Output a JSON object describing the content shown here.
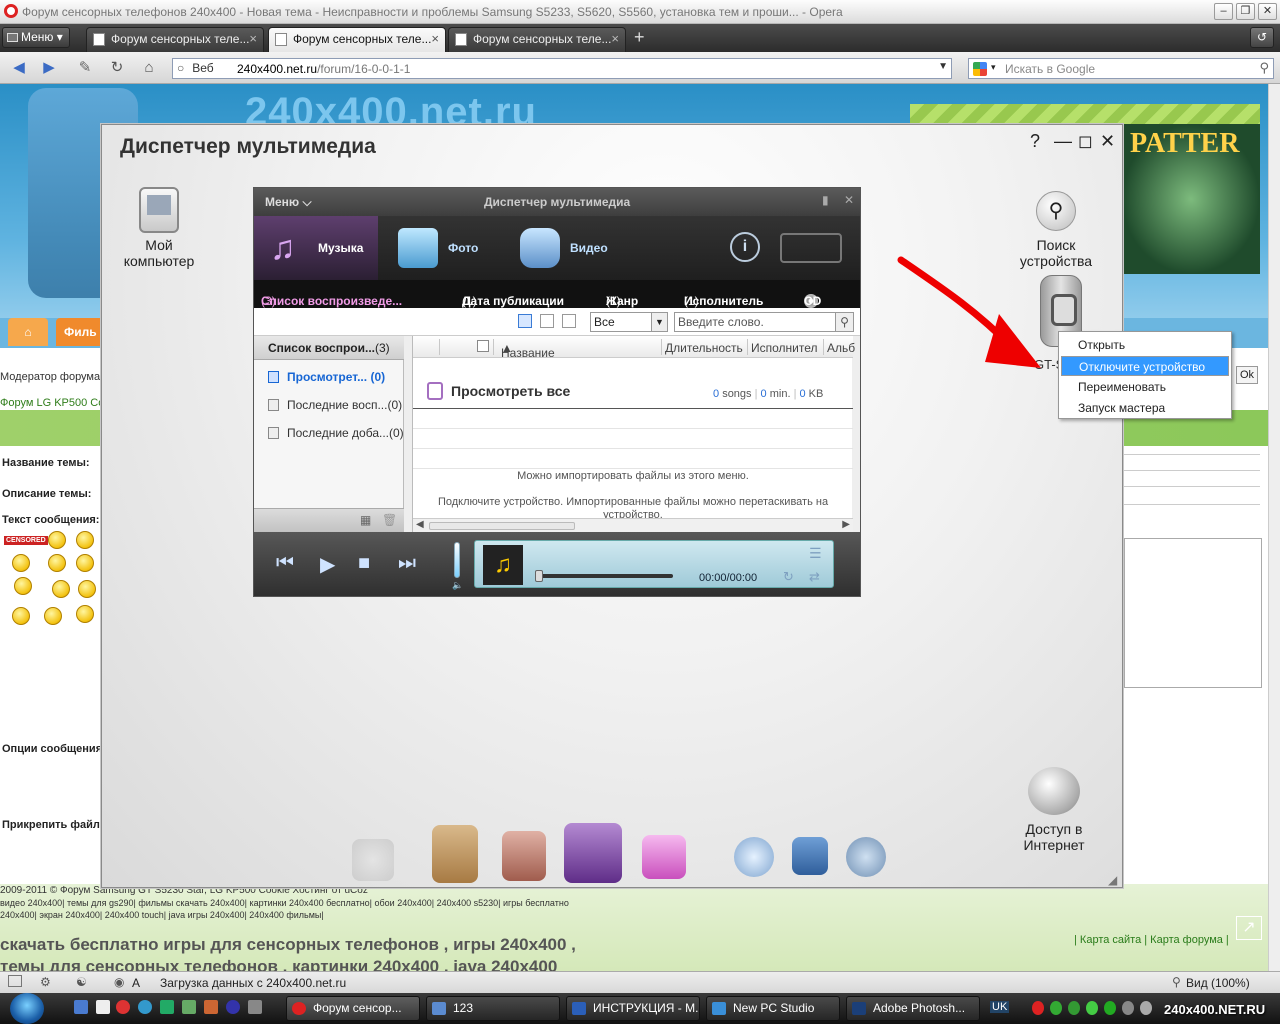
{
  "browser": {
    "title": "Форум сенсорных телефонов 240x400 - Новая тема - Неисправности и проблемы Samsung S5233, S5620, S5560, установка тем и проши... - Opera",
    "menu_label": "Меню",
    "tabs": [
      {
        "label": "Форум сенсорных теле..."
      },
      {
        "label": "Форум сенсорных теле..."
      },
      {
        "label": "Форум сенсорных теле..."
      }
    ],
    "address_mode": "Веб",
    "url_host": "240x400.net.ru",
    "url_path": "/forum/16-0-0-1-1",
    "search_placeholder": "Искать в Google",
    "status_text": "Загрузка данных с 240x400.net.ru",
    "zoom": "Вид (100%)",
    "status_a": "A"
  },
  "webpage": {
    "banner_text": "240x400.net.ru",
    "patter": "PATTER",
    "film_tab": "Филь",
    "moderator": "Модератор форума:",
    "forum_link": "Форум LG KP500 Coo",
    "topic_name": "Название темы:",
    "topic_desc": "Описание темы:",
    "message_text": "Текст сообщения:",
    "msg_options": "Опции сообщения",
    "attach_file": "Прикрепить файл",
    "ok": "Ok",
    "censored": "CENSORED",
    "footer_line1": "2009-2011 © Форум Samsung GT S5230 Star, LG KP500 Cookie Хостинг от uCoz",
    "footer_line2": "видео 240x400| темы для gs290| фильмы скачать 240x400| картинки 240x400 бесплатно| обои 240x400| 240x400 s5230| игры бесплатно",
    "footer_line3": "240x400| экран 240x400| 240x400 touch| java игры 240x400| 240x400 фильмы|",
    "footer_links": "| Карта сайта | Карта форума |",
    "footer_big1": "скачать бесплатно игры для сенсорных телефонов , игры 240x400 ,",
    "footer_big2": "темы для сенсорных телефонов , картинки 240x400 , java 240x400"
  },
  "media_manager": {
    "title": "Диспетчер мультимедиа",
    "help": "?",
    "my_computer": "Мой компьютер",
    "device_search": "Поиск устройства",
    "device_label": "GT-S",
    "internet_access": "Доступ в Интернет",
    "context_menu": [
      "Открыть",
      "Отключите устройство",
      "Переименовать",
      "Запуск мастера"
    ],
    "context_selected_index": 1,
    "inner": {
      "title": "Диспетчер мультимедиа",
      "menu": "Меню",
      "categories": [
        {
          "label": "Музыка"
        },
        {
          "label": "Фото"
        },
        {
          "label": "Видео"
        }
      ],
      "filters": {
        "playlist": "Список воспроизведе...",
        "playlist_count": "(3)",
        "date": "Дата публикации",
        "date_count": "(1)",
        "genre": "Жанр",
        "genre_count": "(1)",
        "artist": "Исполнитель",
        "artist_count": "(1)",
        "cd": "CD"
      },
      "select_value": "Все",
      "search_placeholder": "Введите слово.",
      "left_header": "Список воспрои...",
      "left_header_count": "(3)",
      "left_items": [
        {
          "label": "Просмотрет...",
          "count": "(0)"
        },
        {
          "label": "Последние восп...",
          "count": "(0)"
        },
        {
          "label": "Последние доба...",
          "count": "(0)"
        }
      ],
      "columns": [
        "Название",
        "Длительность",
        "Исполнител",
        "Альб"
      ],
      "view_all": "Просмотреть все",
      "songs_count": "0",
      "songs_label": "songs",
      "min_count": "0",
      "min_label": "min.",
      "kb_count": "0",
      "kb_label": "KB",
      "empty_msg1": "Можно импортировать файлы из этого меню.",
      "empty_msg2": "Подключите устройство. Импортированные файлы можно перетаскивать на устройство.",
      "time": "00:00/00:00"
    }
  },
  "taskbar": {
    "items": [
      {
        "label": "Форум сенсор..."
      },
      {
        "label": "123"
      },
      {
        "label": "ИНСТРУКЦИЯ - М..."
      },
      {
        "label": "New PC Studio"
      },
      {
        "label": "Adobe Photosh..."
      }
    ],
    "lang": "UK",
    "watermark": "240x400.NET.RU"
  }
}
